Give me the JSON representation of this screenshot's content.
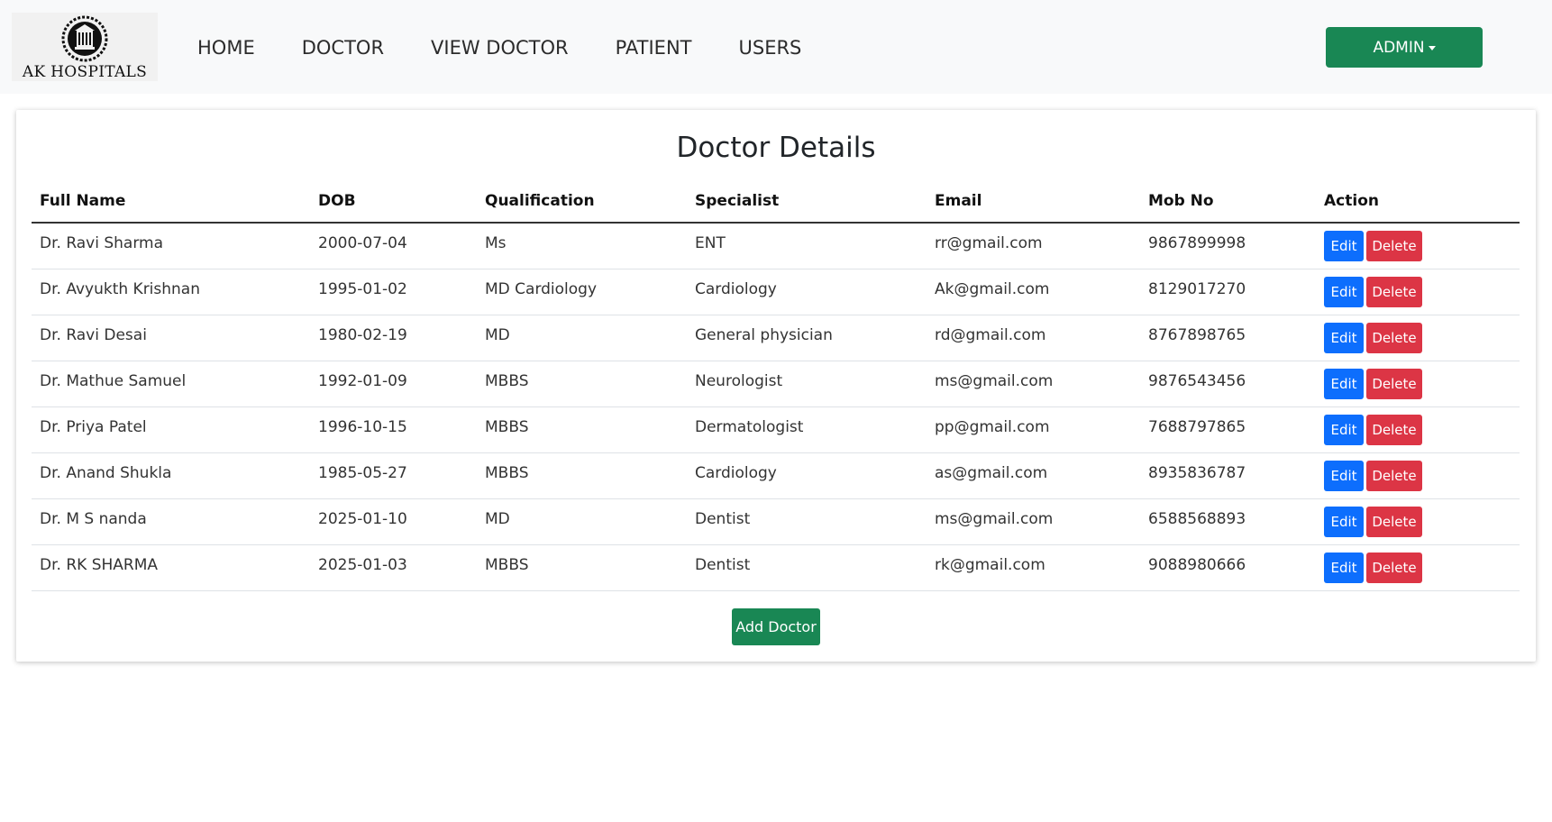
{
  "brand": {
    "name": "AK HOSPITALS"
  },
  "nav": {
    "links": [
      "HOME",
      "DOCTOR",
      "VIEW DOCTOR",
      "PATIENT",
      "USERS"
    ],
    "admin_label": "ADMIN"
  },
  "main": {
    "title": "Doctor Details",
    "columns": [
      "Full Name",
      "DOB",
      "Qualification",
      "Specialist",
      "Email",
      "Mob No",
      "Action"
    ],
    "rows": [
      [
        "Dr. Ravi Sharma",
        "2000-07-04",
        "Ms",
        "ENT",
        "rr@gmail.com",
        "9867899998"
      ],
      [
        "Dr. Avyukth Krishnan",
        "1995-01-02",
        "MD Cardiology",
        "Cardiology",
        "Ak@gmail.com",
        "8129017270"
      ],
      [
        "Dr. Ravi Desai",
        "1980-02-19",
        "MD",
        "General physician",
        "rd@gmail.com",
        "8767898765"
      ],
      [
        "Dr. Mathue Samuel",
        "1992-01-09",
        "MBBS",
        "Neurologist",
        "ms@gmail.com",
        "9876543456"
      ],
      [
        "Dr. Priya Patel",
        "1996-10-15",
        "MBBS",
        "Dermatologist",
        "pp@gmail.com",
        "7688797865"
      ],
      [
        "Dr. Anand Shukla",
        "1985-05-27",
        "MBBS",
        "Cardiology",
        "as@gmail.com",
        "8935836787"
      ],
      [
        "Dr. M S nanda",
        "2025-01-10",
        "MD",
        "Dentist",
        "ms@gmail.com",
        "6588568893"
      ],
      [
        "Dr. RK SHARMA",
        "2025-01-03",
        "MBBS",
        "Dentist",
        "rk@gmail.com",
        "9088980666"
      ]
    ],
    "edit_label": "Edit",
    "delete_label": "Delete",
    "add_label": "Add Doctor"
  },
  "colors": {
    "navbar_bg": "#f8f9fa",
    "success": "#198754",
    "primary": "#0d6efd",
    "danger": "#dc3545"
  },
  "icons": {
    "logo": "hospital-emblem-icon",
    "admin_caret": "caret-down-icon"
  }
}
